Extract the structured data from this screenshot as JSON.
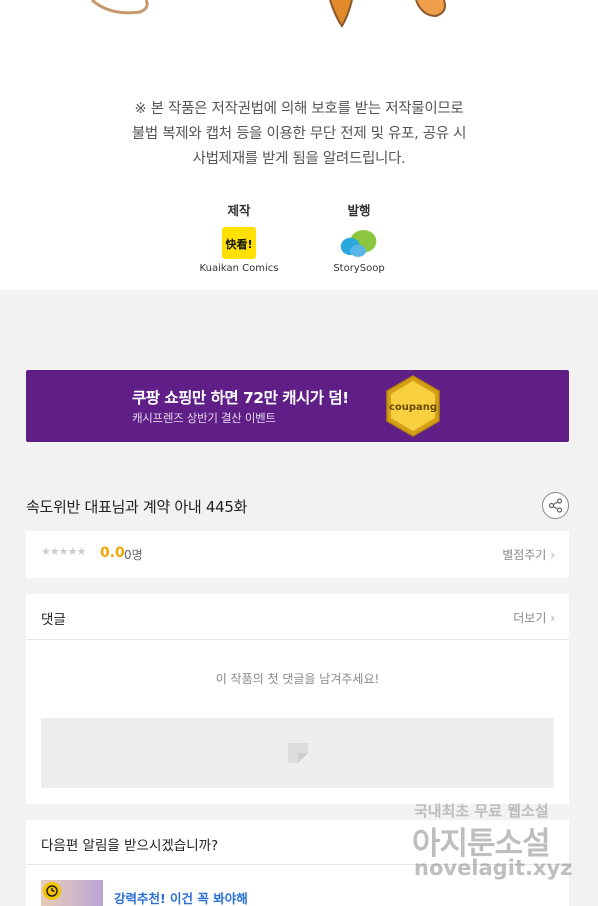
{
  "copyright": {
    "line1": "※ 본 작품은 저작권법에 의해 보호를 받는 저작물이므로",
    "line2": "불법 복제와 캡처 등을  이용한 무단 전제 및 유포, 공유 시",
    "line3": "사법제재를 받게 됨을 알려드립니다."
  },
  "credits": {
    "production_label": "제작",
    "production_logo_text": "快看!",
    "production_name": "Kuaikan Comics",
    "publisher_label": "발행",
    "publisher_name": "StorySoop"
  },
  "banner": {
    "title": "쿠팡 쇼핑만 하면 72만 캐시가 덤!",
    "subtitle": "캐시프렌즈 상반기 결산 이벤트",
    "badge_text": "coupang",
    "bg_color": "#5f1f87"
  },
  "episode": {
    "title": "속도위반 대표님과 계약 아내 445화",
    "share_icon": "share-icon"
  },
  "rating": {
    "stars": "★★★★★",
    "score": "0.0",
    "count": "0명",
    "rate_link": "별점주기",
    "score_color": "#f0a500"
  },
  "comments": {
    "title": "댓글",
    "more": "더보기",
    "empty_message": "이 작품의 첫 댓글을 남겨주세요!"
  },
  "notify": {
    "question": "다음편 알림을 받으시겠습니까?",
    "recommend": "강력추천! 이건 꼭 봐야해"
  },
  "watermark": {
    "line1": "국내최초 무료 웹소설",
    "line2": "아지툰소설",
    "line3": "novelagit.xyz"
  }
}
